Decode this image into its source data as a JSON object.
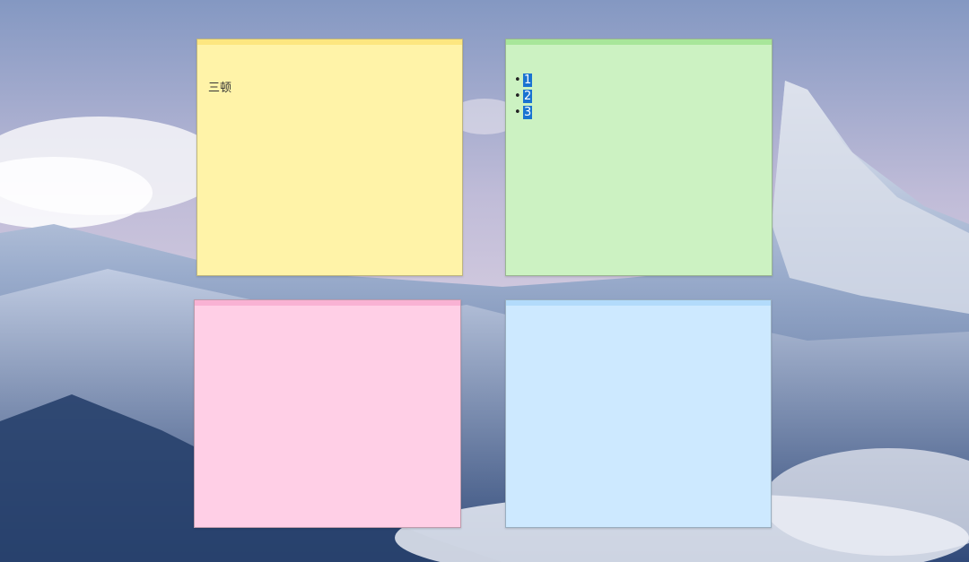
{
  "colors": {
    "yellow_body": "#fff3a8",
    "yellow_header": "#fde680",
    "green_body": "#ccf2c2",
    "green_header": "#a8e69a",
    "pink_body": "#ffcfe6",
    "pink_header": "#f9b2d4",
    "blue_body": "#cde9ff",
    "blue_header": "#b2dbfb",
    "selection": "#1a73d1"
  },
  "notes": [
    {
      "color": "yellow",
      "text": "三顿"
    },
    {
      "color": "green",
      "items": [
        "1",
        "2",
        "3"
      ]
    },
    {
      "color": "pink",
      "text": ""
    },
    {
      "color": "blue",
      "text": ""
    }
  ]
}
